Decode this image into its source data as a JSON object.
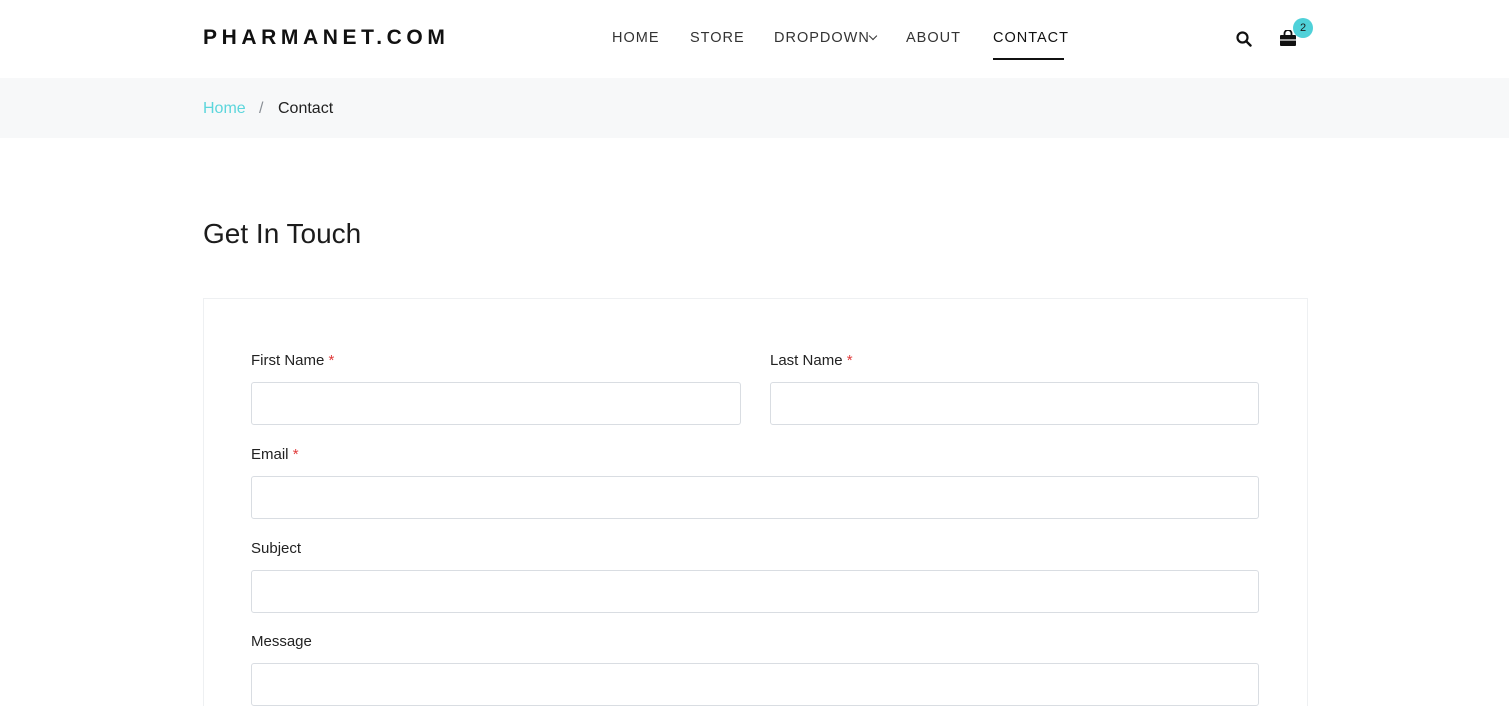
{
  "header": {
    "logo": "PHARMANET.COM",
    "nav": [
      {
        "label": "HOME"
      },
      {
        "label": "STORE"
      },
      {
        "label": "DROPDOWN"
      },
      {
        "label": "ABOUT"
      },
      {
        "label": "CONTACT",
        "active": true
      }
    ],
    "icons": {
      "search": "search-icon",
      "cart": "shopping-bag-icon"
    },
    "cart_count": "2"
  },
  "breadcrumb": {
    "home": "Home",
    "separator": "/",
    "current": "Contact"
  },
  "page_title": "Get In Touch",
  "form": {
    "first_name": {
      "label": "First Name",
      "required_mark": "*",
      "value": ""
    },
    "last_name": {
      "label": "Last Name",
      "required_mark": "*",
      "value": ""
    },
    "email": {
      "label": "Email",
      "required_mark": "*",
      "value": ""
    },
    "subject": {
      "label": "Subject",
      "value": ""
    },
    "message": {
      "label": "Message",
      "value": ""
    }
  },
  "colors": {
    "accent": "#4fd1d9",
    "breadcrumb_link": "#5cd6dc",
    "required": "#e03a3a",
    "breadcrumb_bg": "#f7f8f9"
  }
}
